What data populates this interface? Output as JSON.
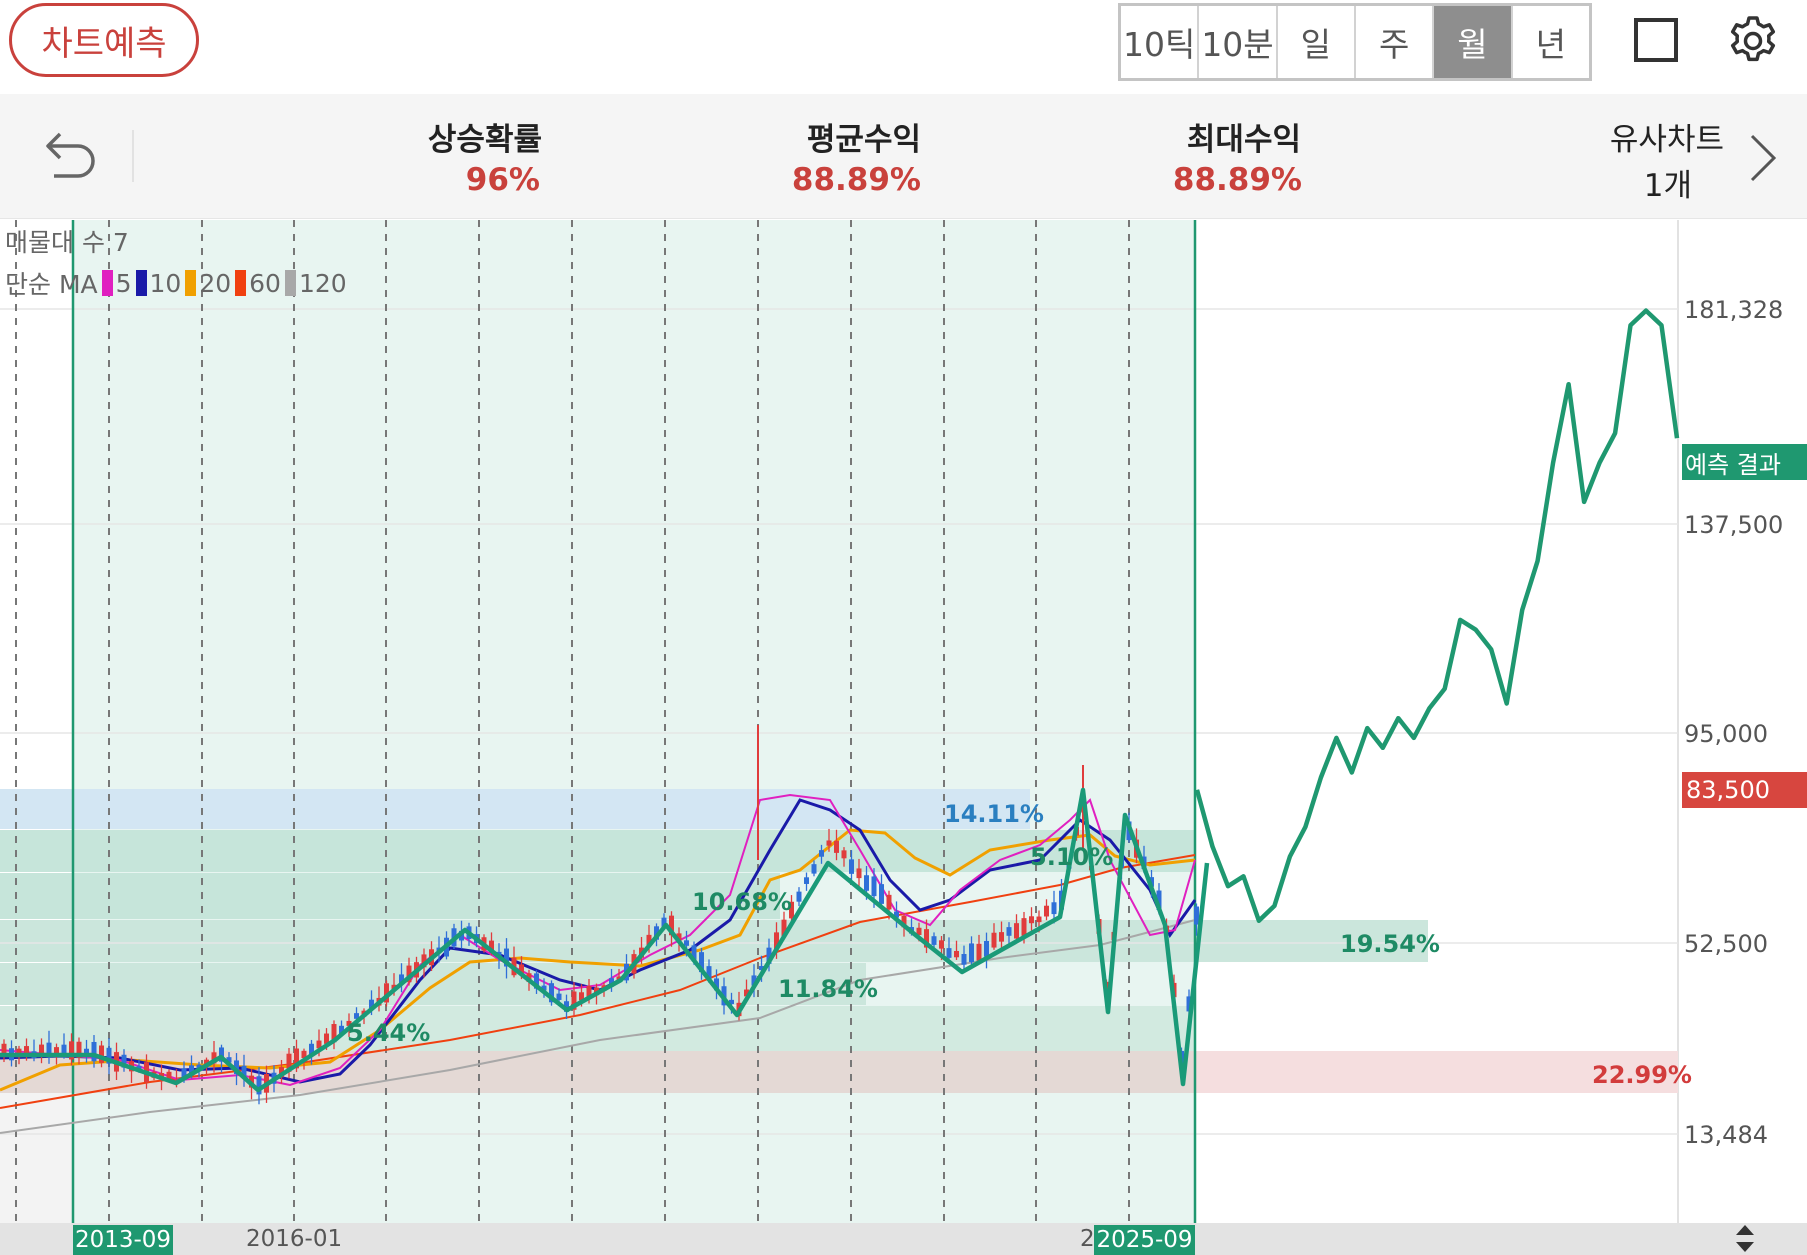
{
  "toolbar": {
    "predict_button": "차트예측",
    "periods": [
      "10틱",
      "10분",
      "일",
      "주",
      "월",
      "년"
    ],
    "active_period": "월"
  },
  "stats": {
    "rise_probability": {
      "label": "상승확률",
      "value": "96%"
    },
    "avg_return": {
      "label": "평균수익",
      "value": "88.89%"
    },
    "max_return": {
      "label": "최대수익",
      "value": "88.89%"
    },
    "similar_charts": {
      "label": "유사차트",
      "count": "1개"
    }
  },
  "legend": {
    "supply_count": "매물대 수 7",
    "ma_title": "단순 MA",
    "ma_periods": [
      {
        "period": "5",
        "color": "#e020c0"
      },
      {
        "period": "10",
        "color": "#1a1aa8"
      },
      {
        "period": "20",
        "color": "#f0a000"
      },
      {
        "period": "60",
        "color": "#f04010"
      },
      {
        "period": "120",
        "color": "#a8a8a8"
      }
    ]
  },
  "percent_labels": [
    {
      "text": "14.11%",
      "color": "#2a7fc0"
    },
    {
      "text": "5.10%",
      "color": "#1e8a64"
    },
    {
      "text": "10.68%",
      "color": "#1e8a64"
    },
    {
      "text": "11.84%",
      "color": "#1e8a64"
    },
    {
      "text": "5.44%",
      "color": "#1e8a64"
    },
    {
      "text": "19.54%",
      "color": "#1e8a64"
    },
    {
      "text": "22.99%",
      "color": "#d23c3c"
    }
  ],
  "y_axis": {
    "labels": [
      "181,328",
      "137,500",
      "95,000",
      "52,500",
      "13,484"
    ],
    "current_price": "83,500",
    "prediction_tag": "예측 결과"
  },
  "x_axis": {
    "start_tag": "2013-09",
    "mid_label": "2016-01",
    "partial_label": "2",
    "end_tag": "2025-09"
  },
  "colors": {
    "accent_red": "#c9413c",
    "accent_green": "#1f9870",
    "up_candle": "#e03c3c",
    "down_candle": "#2f6fd8"
  },
  "chart_data": {
    "type": "line",
    "title": "",
    "y_ticks": [
      181328,
      137500,
      95000,
      52500,
      13484
    ],
    "current_price": 83500,
    "prediction_series": {
      "name": "예측 결과",
      "values": [
        83500,
        72000,
        64000,
        66000,
        57000,
        60000,
        70000,
        76000,
        86000,
        94000,
        87000,
        96000,
        92000,
        98000,
        94000,
        100000,
        104000,
        118000,
        116000,
        112000,
        101000,
        120000,
        130000,
        150000,
        166000,
        142000,
        150000,
        156000,
        178000,
        181000,
        178000,
        155000
      ]
    }
  }
}
